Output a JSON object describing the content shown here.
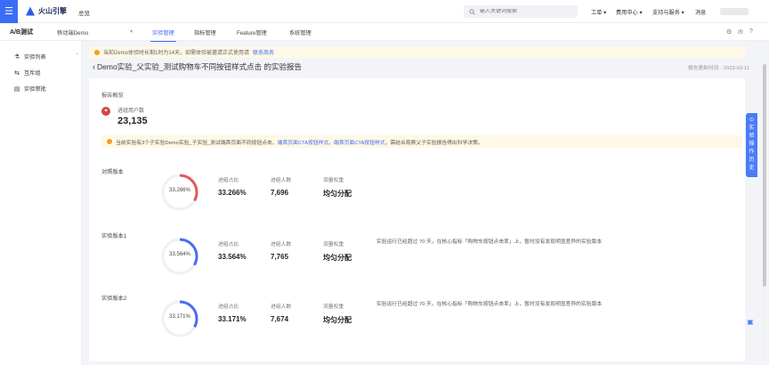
{
  "topbar": {
    "menu_icon": "menu-icon",
    "logo_text": "火山引擎",
    "home": "总览",
    "search_placeholder": "输入关键词搜索",
    "nav": [
      "工单",
      "费用中心",
      "支持与服务",
      "消息"
    ]
  },
  "subbar": {
    "title": "A/B测试",
    "app": "移动端Demo",
    "tabs": [
      "实验管理",
      "指标管理",
      "Feature管理",
      "系统管理"
    ],
    "active_tab": "实验管理"
  },
  "sidebar": {
    "items": [
      {
        "icon": "flask-icon",
        "label": "实验列表"
      },
      {
        "icon": "swap-icon",
        "label": "互斥组"
      },
      {
        "icon": "review-icon",
        "label": "实验审批"
      }
    ]
  },
  "banner": {
    "text": "当前Demo体验时长剩1时为14天，如需体验被邀请正式使用请",
    "link": "联系商务"
  },
  "header": {
    "title": "Demo实验_父实验_测试购物车不同按钮样式点击 的实验报告",
    "report_time": "报告更新时间 · 2023-03-11"
  },
  "overview": {
    "section_title": "报告概览",
    "metric_label": "进组用户数",
    "metric_value": "23,135",
    "notice_prefix": "当前实验有3个子实验Demo实验_子实验_测试端首页面不同按钮点击、",
    "notice_blue1": "端首页面CTA按钮样式",
    "notice_mid": "、",
    "notice_blue2": "端首页面CTA按钮样式",
    "notice_suffix": "，需结合观察父子实验报告得出科学决策。"
  },
  "labels": {
    "ratio": "进组占比",
    "users": "进组人数",
    "weight": "流量权重"
  },
  "variants": [
    {
      "name": "对照版本",
      "ratio": "33.266%",
      "ratio_value": 33.266,
      "users": "7,696",
      "weight": "均匀分配",
      "note": "",
      "color": "#e05a5a"
    },
    {
      "name": "实验版本1",
      "ratio": "33.564%",
      "ratio_value": 33.564,
      "users": "7,765",
      "weight": "均匀分配",
      "note": "实验运行已经超过 70 天，在核心指标「购物车按钮点击率」上，暂时没有发现明显差异的实验版本",
      "color": "#4a6cf0"
    },
    {
      "name": "实验版本2",
      "ratio": "33.171%",
      "ratio_value": 33.171,
      "users": "7,674",
      "weight": "均匀分配",
      "note": "实验运行已经超过 70 天，在核心指标「购物车按钮点击率」上，暂时没有发现明显差异的实验版本",
      "color": "#4a6cf0"
    }
  ],
  "float_panel": "实验操作历史"
}
